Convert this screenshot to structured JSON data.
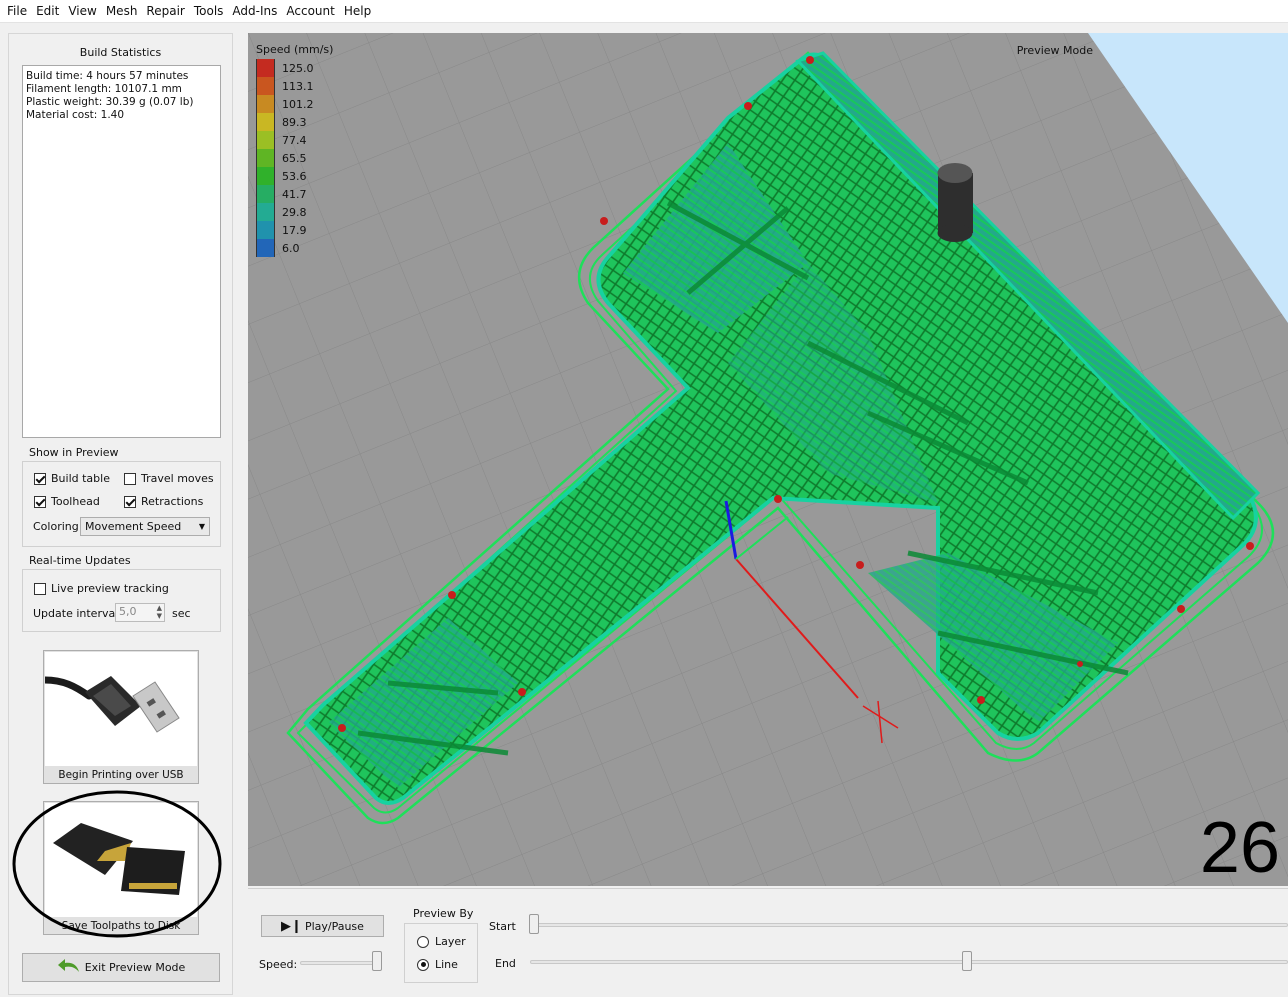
{
  "menu": [
    "File",
    "Edit",
    "View",
    "Mesh",
    "Repair",
    "Tools",
    "Add-Ins",
    "Account",
    "Help"
  ],
  "build_stats": {
    "title": "Build Statistics",
    "lines": [
      "Build time: 4 hours 57 minutes",
      "Filament length: 10107.1 mm",
      "Plastic weight: 30.39 g (0.07 lb)",
      "Material cost: 1.40"
    ]
  },
  "show_in_preview": {
    "title": "Show in Preview",
    "build_table": {
      "label": "Build table",
      "checked": true
    },
    "travel_moves": {
      "label": "Travel moves",
      "checked": false
    },
    "toolhead": {
      "label": "Toolhead",
      "checked": true
    },
    "retractions": {
      "label": "Retractions",
      "checked": true
    },
    "coloring_label": "Coloring",
    "coloring_value": "Movement Speed"
  },
  "realtime": {
    "title": "Real-time Updates",
    "live_label": "Live preview tracking",
    "live_checked": false,
    "interval_label": "Update interval",
    "interval_value": "5,0",
    "interval_unit": "sec"
  },
  "usb_button": {
    "label": "Begin Printing over USB"
  },
  "disk_button": {
    "label": "Save Toolpaths to Disk"
  },
  "exit_button": {
    "label": "Exit Preview Mode"
  },
  "viewport": {
    "mode_label": "Preview Mode",
    "layer_number": "26"
  },
  "legend": {
    "title": "Speed (mm/s)",
    "entries": [
      {
        "value": "125.0",
        "color": "#c42b20"
      },
      {
        "value": "113.1",
        "color": "#c9561f"
      },
      {
        "value": "101.2",
        "color": "#c88a22"
      },
      {
        "value": "89.3",
        "color": "#c9b723"
      },
      {
        "value": "77.4",
        "color": "#9bbf24"
      },
      {
        "value": "65.5",
        "color": "#5fb524"
      },
      {
        "value": "53.6",
        "color": "#30b12b"
      },
      {
        "value": "41.7",
        "color": "#26ad63"
      },
      {
        "value": "29.8",
        "color": "#23ab93"
      },
      {
        "value": "17.9",
        "color": "#2092ad"
      },
      {
        "value": "6.0",
        "color": "#2266b8"
      }
    ]
  },
  "controls": {
    "play_label": "Play/Pause",
    "speed_label": "Speed:",
    "preview_by_title": "Preview By",
    "layer_label": "Layer",
    "line_label": "Line",
    "preview_by_value": "Line",
    "start_label": "Start",
    "end_label": "End"
  }
}
